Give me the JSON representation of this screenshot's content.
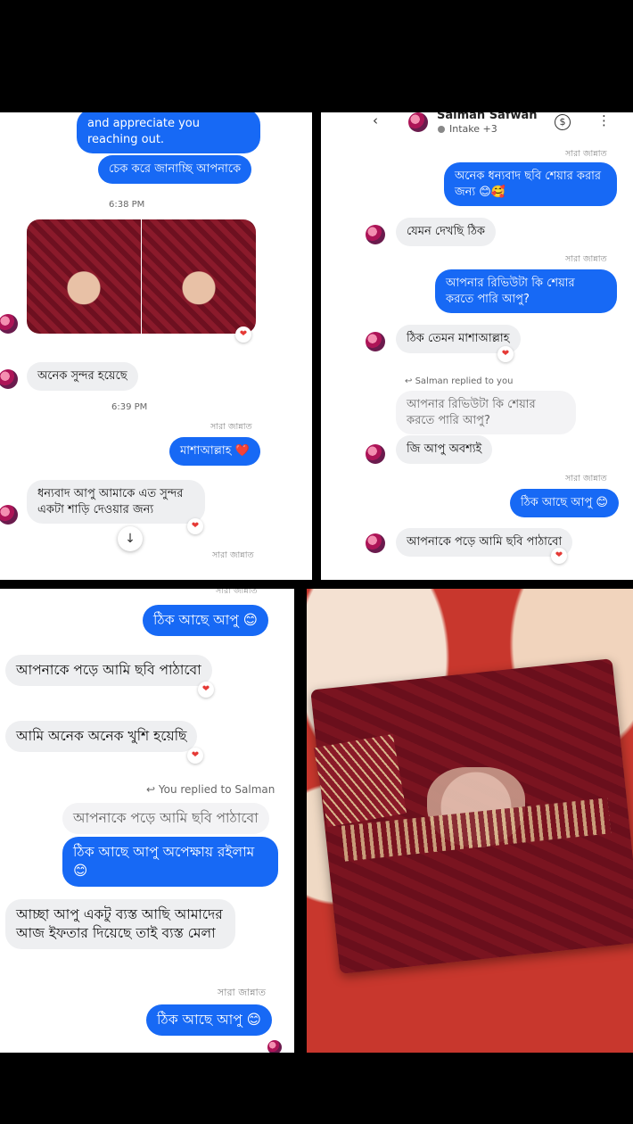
{
  "tl": {
    "m1": "and appreciate you reaching out.",
    "m2": "চেক করে জানাচ্ছি আপনাকে",
    "t1": "6:38 PM",
    "m3": "অনেক সুন্দর হয়েছে",
    "t2": "6:39 PM",
    "sender1": "সারা জান্নাত",
    "m4": "মাশাআল্লাহ ❤️",
    "m5": "ধন্যবাদ আপু আমাকে এত সুন্দর একটা শাড়ি দেওয়ার জন্য",
    "sender2": "সারা জান্নাত",
    "heart": "❤"
  },
  "tr": {
    "contact_name": "Salman Safwan",
    "contact_sub": "Intake +3",
    "back_icon": "‹",
    "dollar_icon": "$",
    "more_icon": "⋮",
    "sender1": "সারা জান্নাত",
    "m1": "অনেক ধন্যবাদ ছবি শেয়ার করার জন্য 😊🥰",
    "m2": "যেমন দেখছি ঠিক",
    "sender2": "সারা জান্নাত",
    "m3": "আপনার রিভিউটা কি শেয়ার করতে পারি আপু?",
    "m4": "ঠিক তেমন মাশাআল্লাহ",
    "reply_tag": "Salman replied to you",
    "m5_quote": "আপনার রিভিউটা কি শেয়ার করতে পারি আপু?",
    "m5": "জি আপু অবশ্যই",
    "sender3": "সারা জান্নাত",
    "m6": "ঠিক আছে আপু 😊",
    "m7": "আপনাকে পড়ে আমি ছবি পাঠাবো",
    "heart": "❤"
  },
  "bl": {
    "sender_top": "সারা জান্নাত",
    "m1": "ঠিক আছে আপু 😊",
    "m2": "আপনাকে পড়ে আমি ছবি পাঠাবো",
    "m3": "আমি অনেক অনেক খুশি হয়েছি",
    "reply_tag": "You replied to Salman",
    "m4_quote": "আপনাকে পড়ে আমি ছবি পাঠাবো",
    "m4": "ঠিক আছে আপু অপেক্ষায় রইলাম 😊",
    "m5": "আচ্ছা আপু একটু ব্যস্ত আছি আমাদের আজ ইফতার দিয়েছে তাই ব্যস্ত মেলা",
    "sender2": "সারা জান্নাত",
    "m6": "ঠিক আছে আপু 😊",
    "heart": "❤"
  }
}
